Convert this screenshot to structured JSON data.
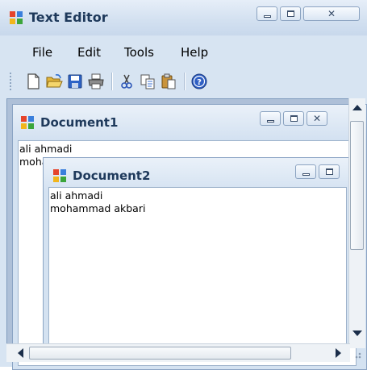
{
  "window": {
    "title": "Text Editor"
  },
  "menu": {
    "items": [
      "File",
      "Edit",
      "Tools",
      "Help"
    ]
  },
  "toolbar": {
    "icons": [
      "new-icon",
      "open-icon",
      "save-icon",
      "print-icon",
      "cut-icon",
      "copy-icon",
      "paste-icon",
      "help-icon"
    ]
  },
  "documents": [
    {
      "title": "Document1",
      "lines": [
        "ali ahmadi",
        "moha"
      ]
    },
    {
      "title": "Document2",
      "lines": [
        "ali ahmadi",
        "mohammad akbari"
      ]
    }
  ],
  "caption_buttons": {
    "close_glyph": "✕"
  }
}
